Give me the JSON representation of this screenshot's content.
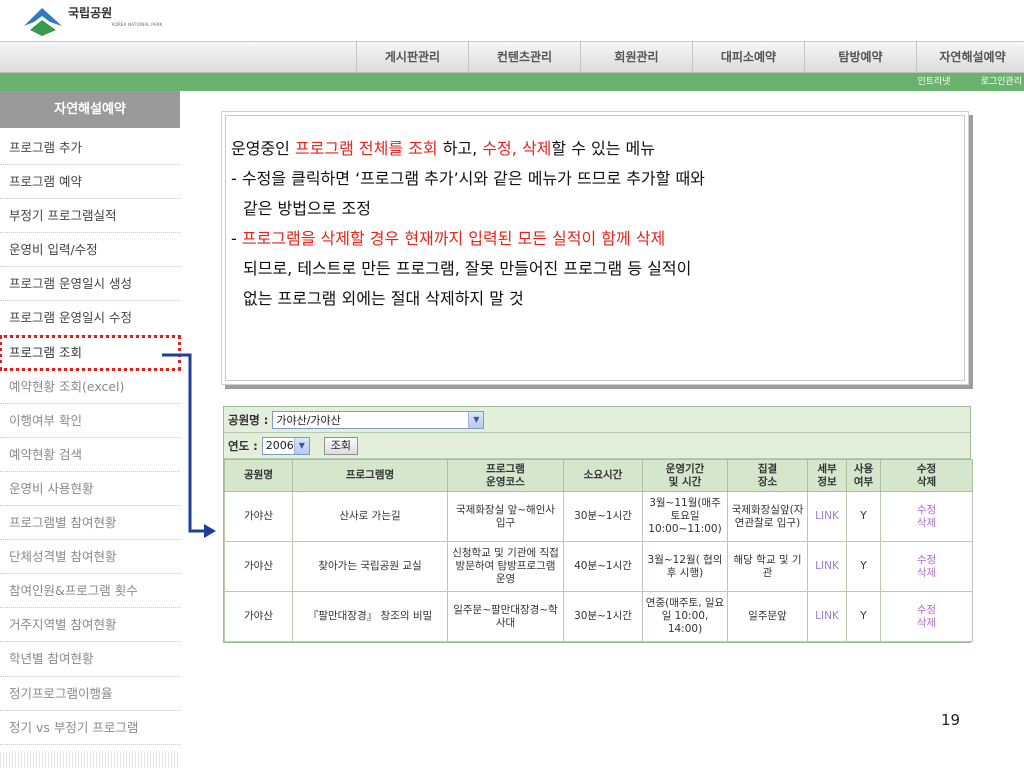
{
  "header": {
    "logo_kr": "국립공원",
    "logo_en": "KOREA NATIONAL PARK",
    "menu": [
      "게시판관리",
      "컨텐츠관리",
      "회원관리",
      "대피소예약",
      "탐방예약",
      "자연해설예약"
    ],
    "util_links": [
      "인트라넷",
      "로그인관리"
    ]
  },
  "sidebar": {
    "title": "자연해설예약",
    "items": [
      "프로그램 추가",
      "프로그램 예약",
      "부정기 프로그램실적",
      "운영비 입력/수정",
      "프로그램 운영일시 생성",
      "프로그램 운영일시 수정",
      "프로그램 조회",
      "예약현황 조회(excel)",
      "이행여부 확인",
      "예약현황 검색",
      "운영비 사용현황",
      "프로그램별 참여현황",
      "단체성격별 참여현황",
      "참여인원&프로그램 횟수",
      "거주지역별 참여현황",
      "학년별 참여현황",
      "정기프로그램이행율",
      "정기 vs 부정기 프로그램"
    ],
    "active_index": 6
  },
  "description": {
    "l1_a": "운영중인 ",
    "l1_b": "프로그램 전체를 조회",
    "l1_c": " 하고, ",
    "l1_d": "수정, 삭제",
    "l1_e": "할 수 있는 메뉴",
    "l2": "- 수정을 클릭하면 ‘프로그램 추가’시와 같은 메뉴가 뜨므로 추가할 때와",
    "l3": "같은 방법으로 조정",
    "l4_a": "- ",
    "l4_b": "프로그램을 삭제할 경우 현재까지 입력된 모든 실적이 함께 삭제",
    "l5": "되므로, 테스트로 만든 프로그램, 잘못 만들어진 프로그램 등 실적이",
    "l6": "없는 프로그램 외에는 절대 삭제하지 말 것"
  },
  "search": {
    "park_label": "공원명 :",
    "park_value": "가야산/가야산",
    "year_label": "연도 :",
    "year_value": "2006",
    "search_button": "조회"
  },
  "table": {
    "headers": [
      "공원명",
      "프로그램명",
      "프로그램\n운영코스",
      "소요시간",
      "운영기간\n및 시간",
      "집결\n장소",
      "세부\n정보",
      "사용\n여부",
      "수정\n삭제"
    ],
    "rows": [
      [
        "가야산",
        "산사로 가는길",
        "국제화장실 앞~해인사 입구",
        "30분~1시간",
        "3월~11월(매주 토요일 10:00~11:00)",
        "국제화장실앞(자연관찰로 입구)",
        "LINK",
        "Y",
        "수정\n삭제"
      ],
      [
        "가야산",
        "찾아가는 국립공원 교실",
        "신청학교 및 기관에 직접 방문하여 탐방프로그램 운영",
        "40분~1시간",
        "3월~12월( 협의후 시행)",
        "해당 학교 및 기관",
        "LINK",
        "Y",
        "수정\n삭제"
      ],
      [
        "가야산",
        "『팔만대장경』 창조의 비밀",
        "일주문~팔만대장경~학사대",
        "30분~1시간",
        "연중(매주토, 일요일 10:00, 14:00)",
        "일주문앞",
        "LINK",
        "Y",
        "수정\n삭제"
      ]
    ]
  },
  "page_number": "19",
  "colors": {
    "green_bar": "#6bb26f",
    "red_highlight": "#e8231a",
    "connector": "#1d3f97"
  }
}
